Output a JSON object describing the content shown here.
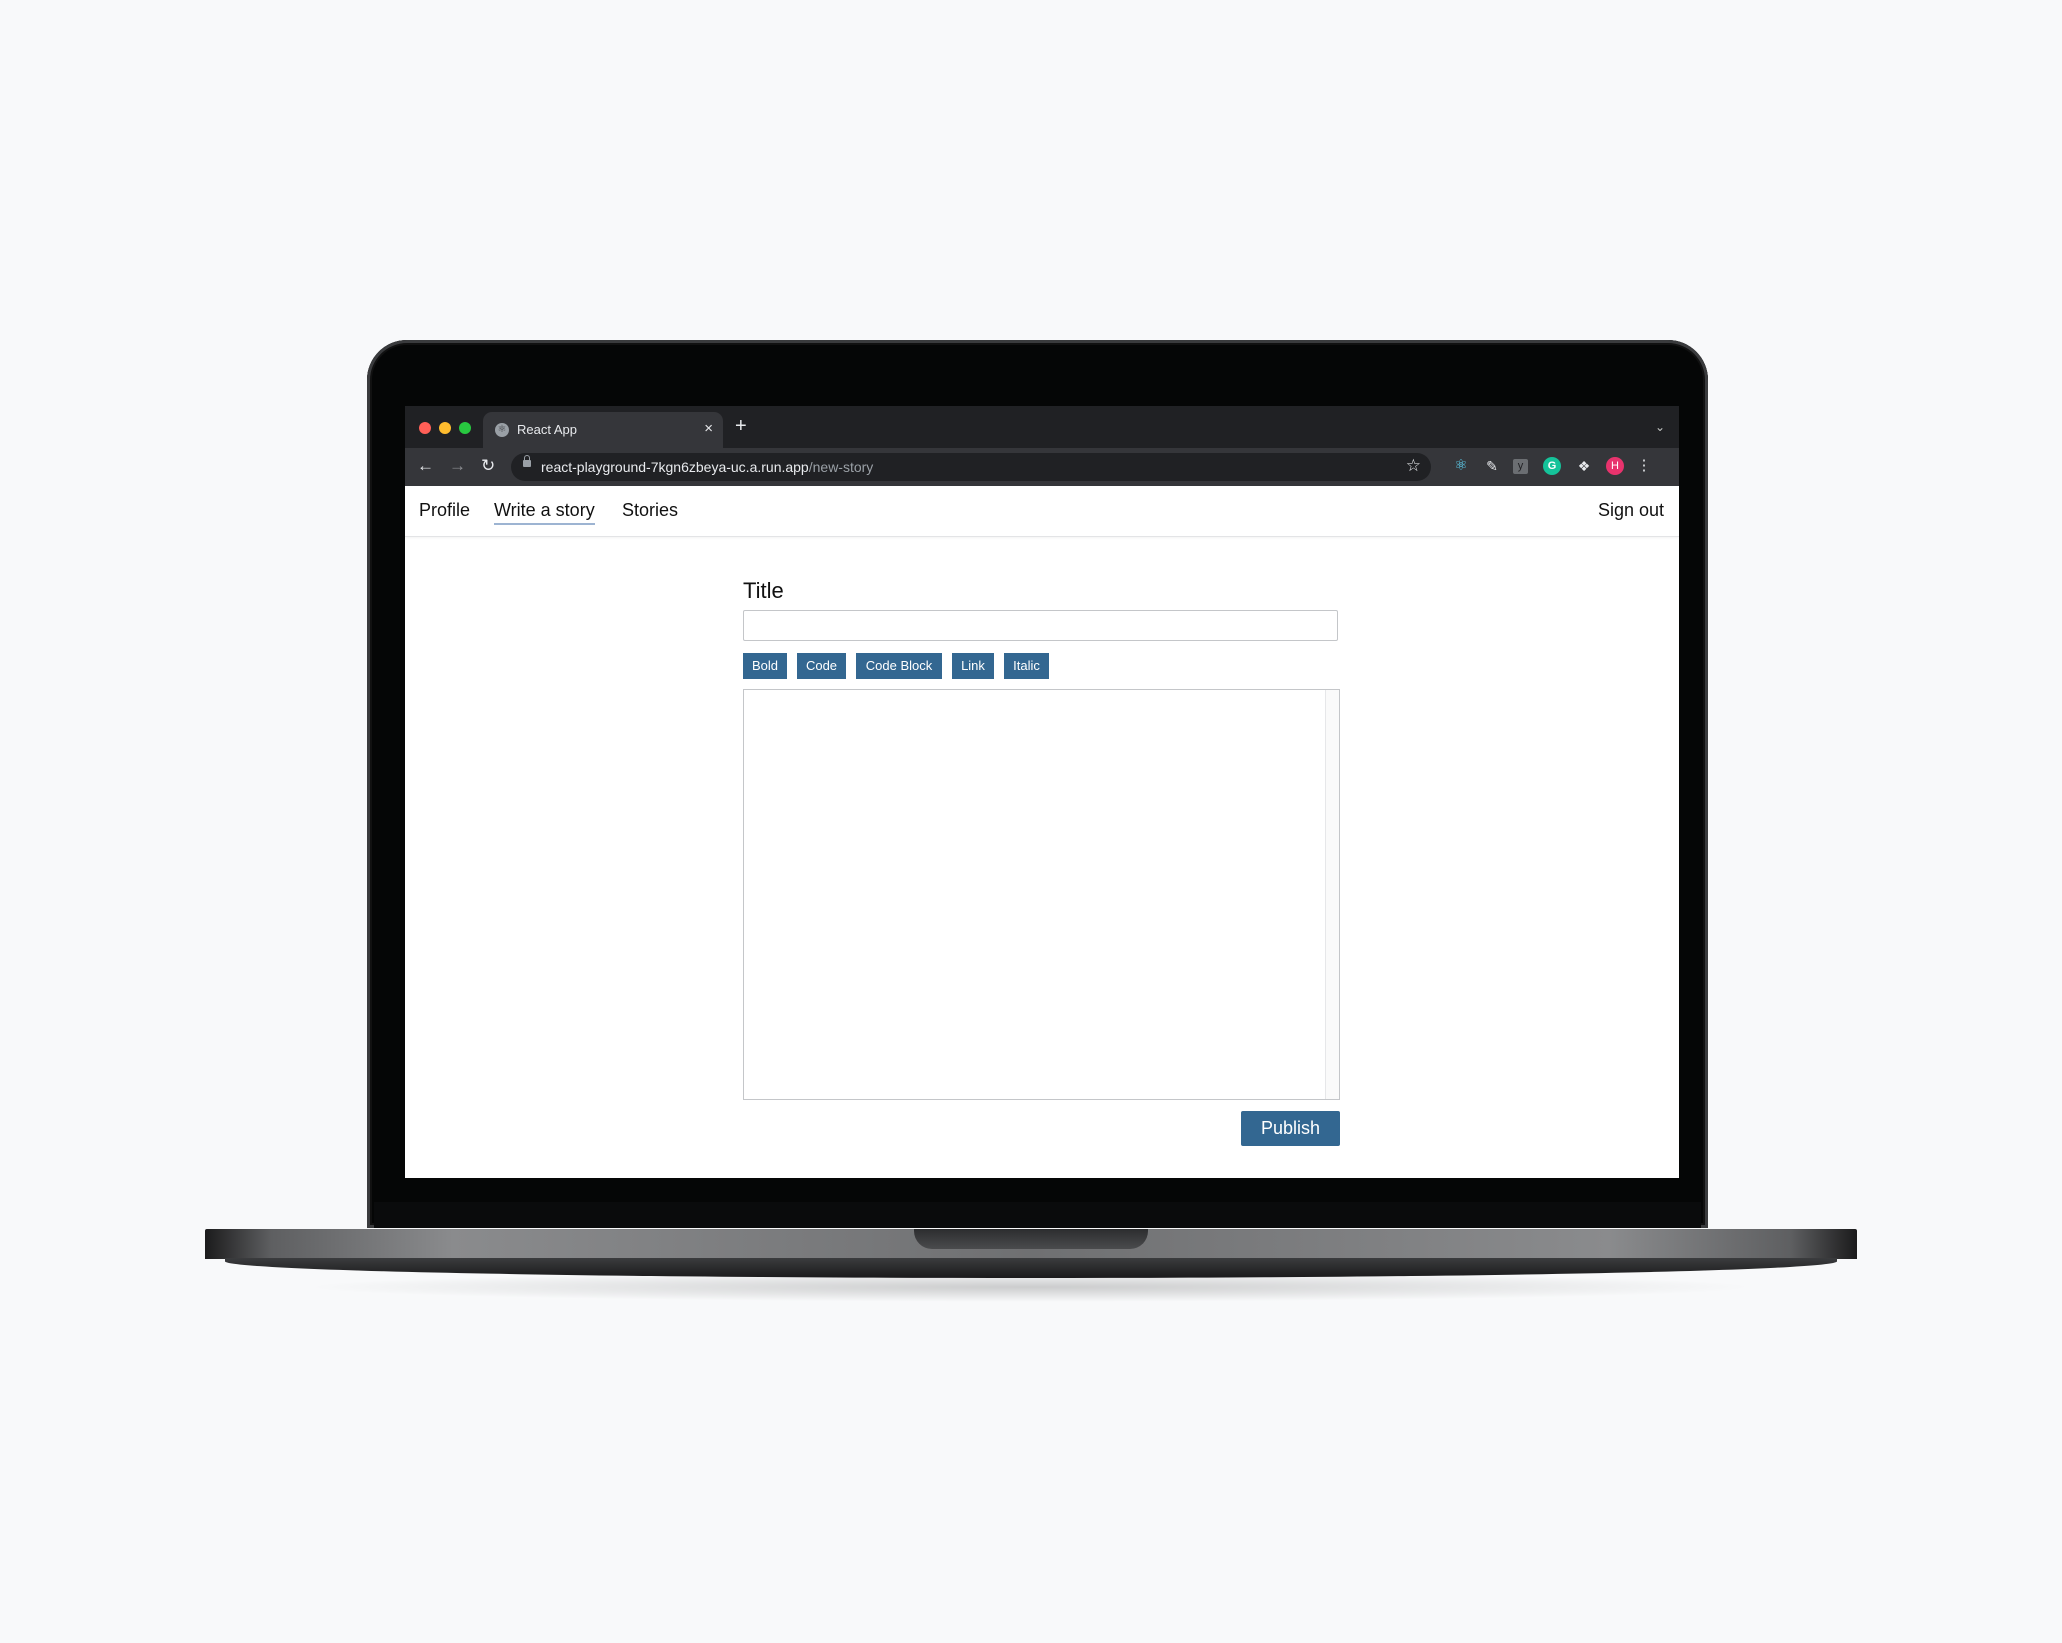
{
  "browser": {
    "tab_title": "React App",
    "tab_favicon": "react-app-favicon",
    "close_tab_symbol": "×",
    "new_tab_symbol": "+",
    "url_host": "react-playground-7kgn6zbeya-uc.a.run.app",
    "url_path": "/new-story",
    "avatar_letter": "H",
    "extensions": [
      "react-devtools-icon",
      "pen-icon",
      "y-extension-icon",
      "grammarly-icon",
      "puzzle-icon"
    ],
    "extension_glyphs": {
      "y": "y",
      "grammarly": "G"
    }
  },
  "nav": {
    "links": [
      "Profile",
      "Write a story",
      "Stories"
    ],
    "active": "Write a story",
    "sign_out": "Sign out"
  },
  "form": {
    "title_label": "Title",
    "title_value": "",
    "format_buttons": [
      "Bold",
      "Code",
      "Code Block",
      "Link",
      "Italic"
    ],
    "body_value": "",
    "publish_label": "Publish"
  },
  "colors": {
    "accent": "#336791",
    "browser_frame": "#202124",
    "active_underline": "#9db4d2"
  }
}
